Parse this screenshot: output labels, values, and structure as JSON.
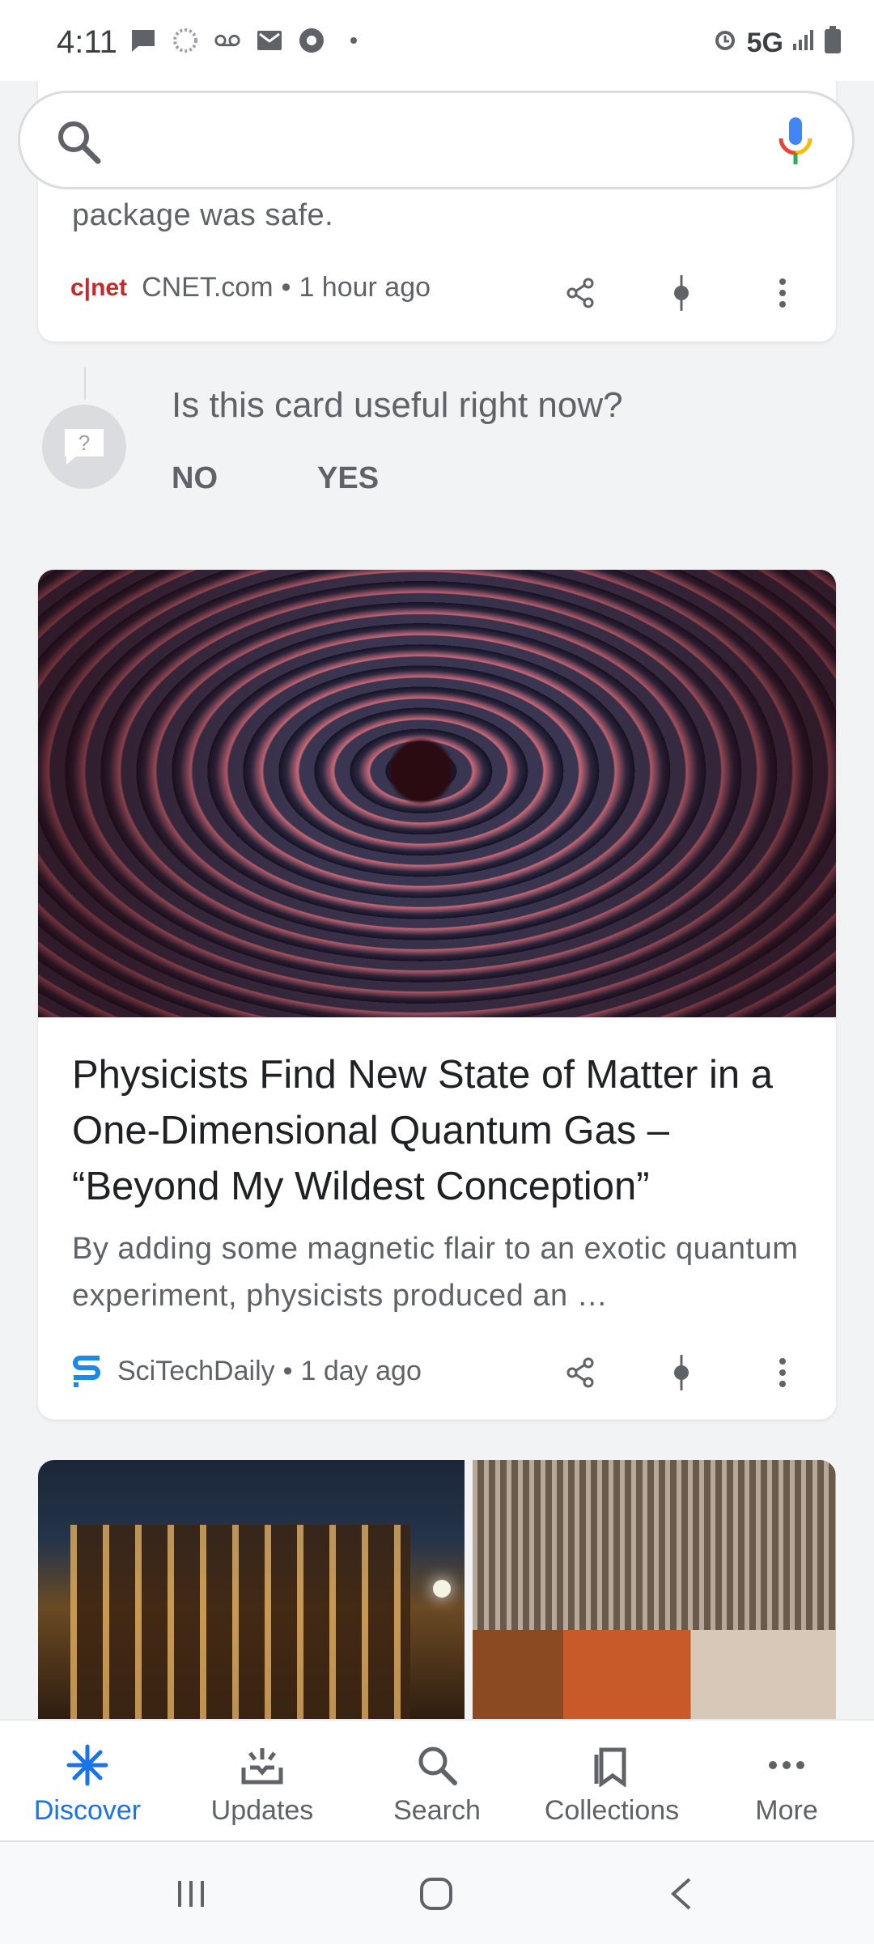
{
  "status_bar": {
    "time": "4:11",
    "network": "5G",
    "icons_left": [
      "chat-icon",
      "loading-icon",
      "voicemail-icon",
      "gmail-icon",
      "chrome-icon",
      "dot-icon"
    ],
    "icons_right": [
      "alarm-icon",
      "signal-icon",
      "battery-icon"
    ]
  },
  "search": {
    "placeholder": ""
  },
  "card1": {
    "snippet": "package was safe.",
    "source": "CNET.com",
    "source_logo": "c|net",
    "time": "1 hour ago"
  },
  "feedback": {
    "question": "Is this card useful right now?",
    "no": "NO",
    "yes": "YES"
  },
  "card2": {
    "title": "Physicists Find New State of Matter in a One-Dimensional Quantum Gas – “Beyond My Wildest Conception”",
    "snippet": "By adding some magnetic flair to an exotic quantum experiment, physicists produced an …",
    "source": "SciTechDaily",
    "time": "1 day ago"
  },
  "bottom_nav": {
    "items": [
      {
        "label": "Discover",
        "icon": "discover-icon",
        "active": true
      },
      {
        "label": "Updates",
        "icon": "updates-icon",
        "active": false
      },
      {
        "label": "Search",
        "icon": "search-icon",
        "active": false
      },
      {
        "label": "Collections",
        "icon": "collections-icon",
        "active": false
      },
      {
        "label": "More",
        "icon": "more-icon",
        "active": false
      }
    ]
  },
  "colors": {
    "accent": "#1a73e8",
    "text_secondary": "#5f6368",
    "cnet_red": "#c62828",
    "scitech_blue": "#1e88e5"
  }
}
